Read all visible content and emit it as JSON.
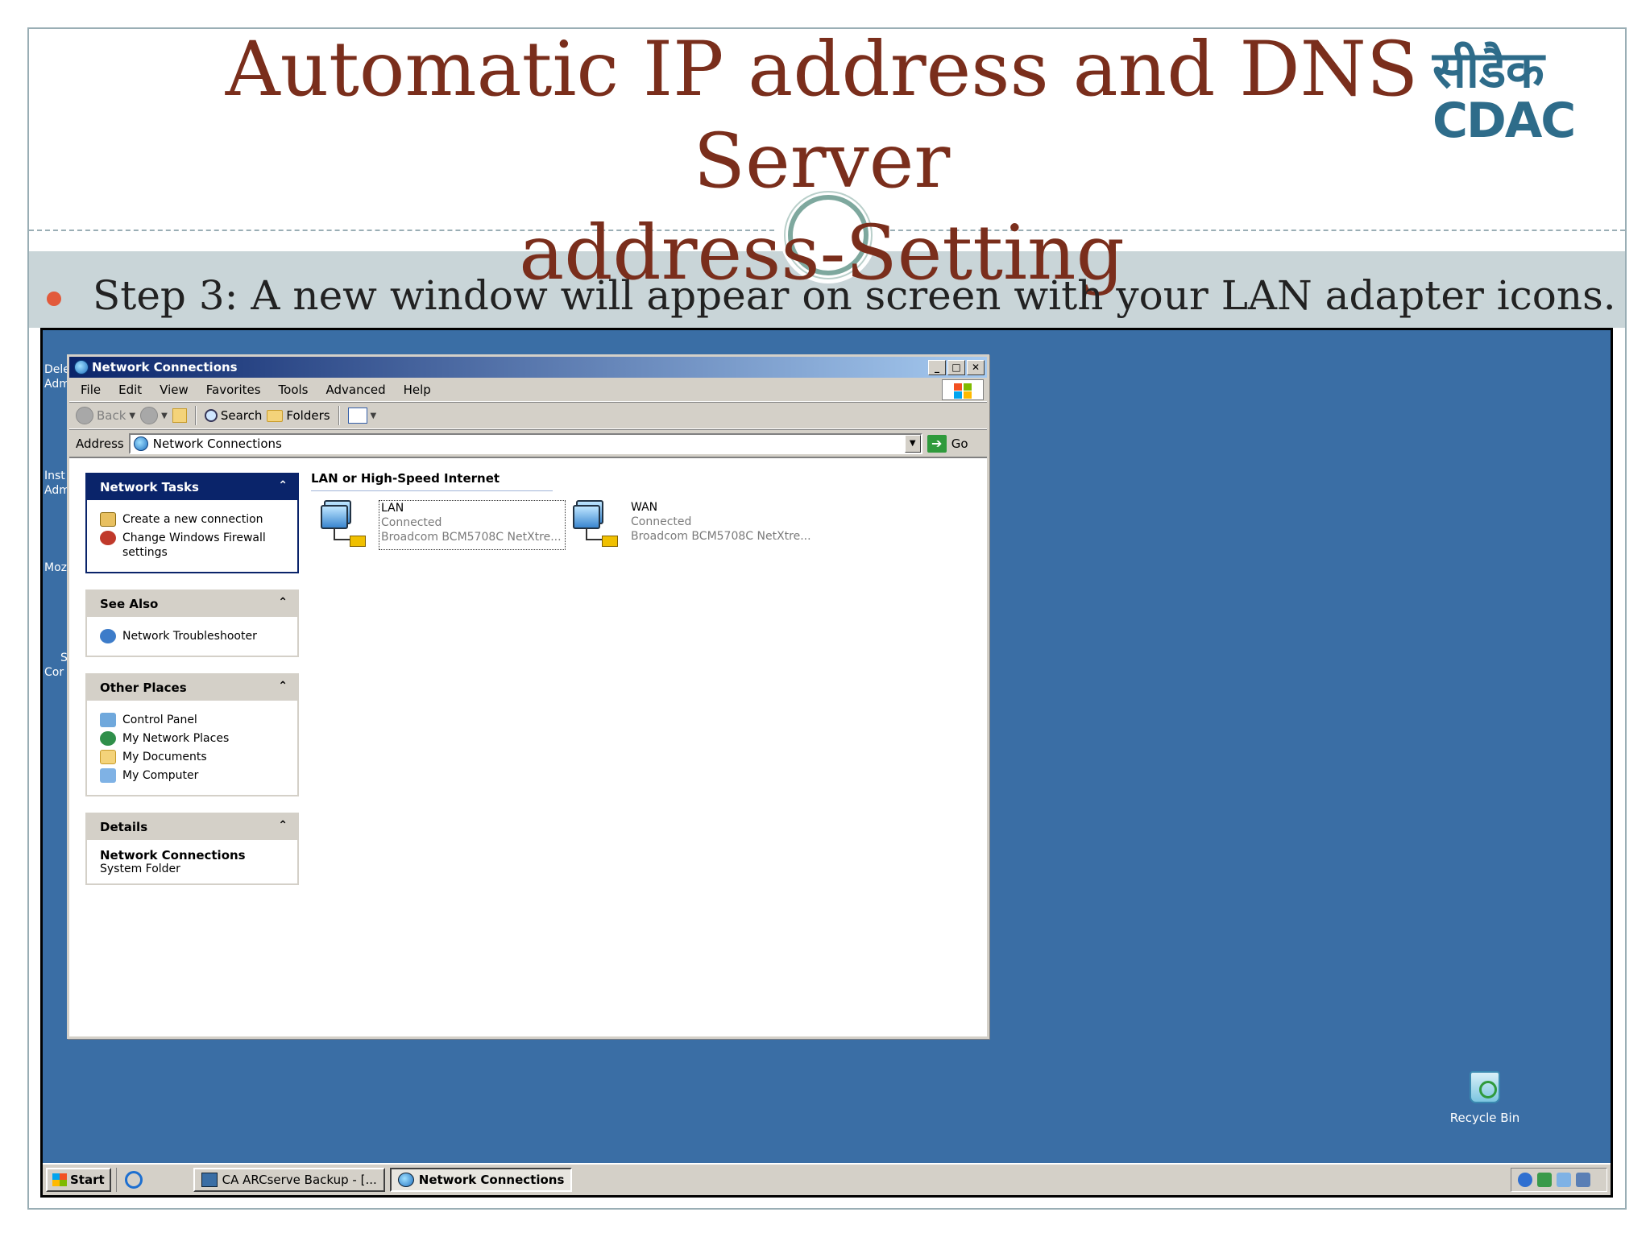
{
  "slide": {
    "title_line1": "Automatic IP address and DNS Server",
    "title_line2": "address-Setting",
    "logo_hindi": "सीडैक",
    "logo_cdac": "CDAC",
    "bullet": "Step 3:  A new window will appear on screen with your LAN adapter icons."
  },
  "desktop": {
    "left_icon_labels": [
      "Dele",
      "Adm",
      "Inst",
      "Adm",
      "Moz",
      "S",
      "Cor"
    ],
    "recycle_bin": "Recycle Bin"
  },
  "window": {
    "title": "Network Connections",
    "buttons": {
      "minimize": "_",
      "maximize": "□",
      "close": "✕"
    },
    "menu": [
      "File",
      "Edit",
      "View",
      "Favorites",
      "Tools",
      "Advanced",
      "Help"
    ],
    "toolbar": {
      "back": "Back",
      "search": "Search",
      "folders": "Folders"
    },
    "address": {
      "label": "Address",
      "value": "Network Connections",
      "go": "Go"
    }
  },
  "task_pane": {
    "network_tasks": {
      "title": "Network Tasks",
      "items": [
        "Create a new connection",
        "Change Windows Firewall settings"
      ]
    },
    "see_also": {
      "title": "See Also",
      "items": [
        "Network Troubleshooter"
      ]
    },
    "other_places": {
      "title": "Other Places",
      "items": [
        "Control Panel",
        "My Network Places",
        "My Documents",
        "My Computer"
      ]
    },
    "details": {
      "title": "Details",
      "name": "Network Connections",
      "type": "System Folder"
    }
  },
  "connections": {
    "group": "LAN or High-Speed Internet",
    "items": [
      {
        "name": "LAN",
        "status": "Connected",
        "device": "Broadcom BCM5708C NetXtre..."
      },
      {
        "name": "WAN",
        "status": "Connected",
        "device": "Broadcom BCM5708C NetXtre..."
      }
    ]
  },
  "taskbar": {
    "start": "Start",
    "tasks": [
      "CA ARCserve Backup - [...",
      "Network Connections"
    ]
  },
  "colors": {
    "title_text": "#7a2e1c",
    "logo": "#2e6c8a",
    "bullet_dot": "#e25a3b",
    "desktop": "#3a6ea5",
    "titlebar": "#0a246a"
  }
}
